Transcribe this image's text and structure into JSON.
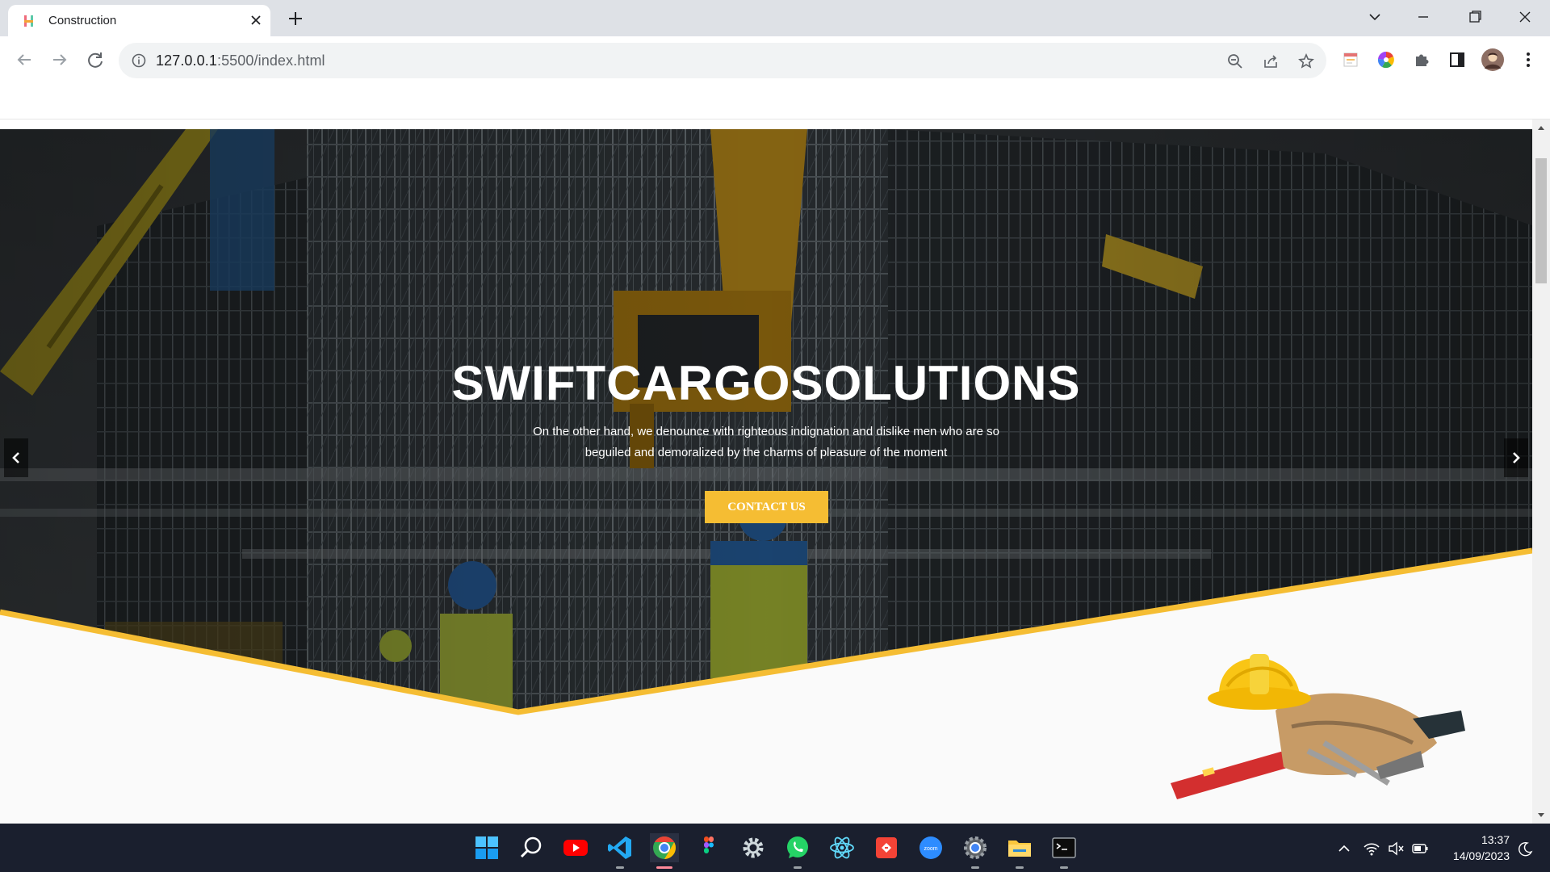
{
  "browser": {
    "tab_title": "Construction",
    "url_host": "127.0.0.1",
    "url_path": ":5500/index.html"
  },
  "hero": {
    "title": "SWIFTCARGOSOLUTIONS",
    "subtitle_line1": "On the other hand, we denounce with righteous indignation and dislike men who are so",
    "subtitle_line2": "beguiled and demoralized by the charms of pleasure of the moment",
    "cta_label": "CONTACT US"
  },
  "taskbar": {
    "apps": [
      "windows-start",
      "search",
      "youtube",
      "vscode",
      "chrome",
      "figma",
      "settings",
      "whatsapp",
      "react",
      "git-app",
      "zoom",
      "chrome-settings",
      "file-explorer",
      "terminal"
    ],
    "time": "13:37",
    "date": "14/09/2023"
  },
  "colors": {
    "accent": "#f5bd33",
    "tabbar": "#dee1e6",
    "taskbar": "#1a1f2e"
  }
}
